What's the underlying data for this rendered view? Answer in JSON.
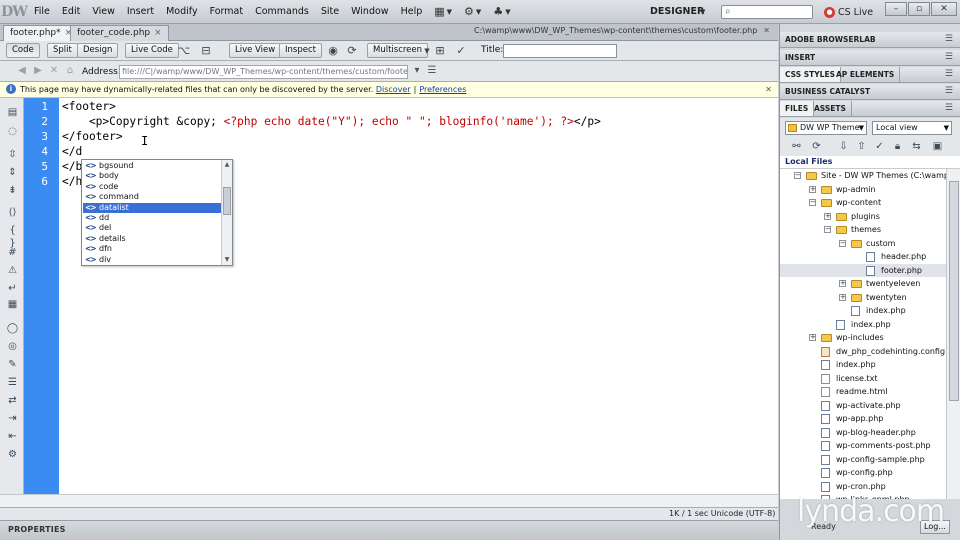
{
  "app": {
    "logo": "DW",
    "workspace": "DESIGNER",
    "cslive": "CS Live",
    "cslive_badge": "●",
    "search_glyph": "⌕"
  },
  "menu": [
    "File",
    "Edit",
    "View",
    "Insert",
    "Modify",
    "Format",
    "Commands",
    "Site",
    "Window",
    "Help"
  ],
  "tabs": [
    {
      "label": "footer.php*"
    },
    {
      "label": "footer_code.php"
    }
  ],
  "file_path": "C:\\wamp\\www\\DW_WP_Themes\\wp-content\\themes\\custom\\footer.php",
  "toolbar": {
    "code": "Code",
    "split": "Split",
    "design": "Design",
    "live_code": "Live Code",
    "live_view": "Live View",
    "inspect": "Inspect",
    "multiscreen": "Multiscreen",
    "title_label": "Title:",
    "title_value": ""
  },
  "address": {
    "label": "Address:",
    "value": "file:///C|/wamp/www/DW_WP_Themes/wp-content/themes/custom/footer.php"
  },
  "infobar": {
    "message": "This page may have dynamically-related files that can only be discovered by the server.",
    "discover": "Discover",
    "separator": "|",
    "preferences": "Preferences"
  },
  "code": {
    "line_numbers": [
      "1",
      "2",
      "3",
      "4",
      "5",
      "6"
    ],
    "lines": [
      {
        "a": "<footer>",
        "b": "",
        "c": ""
      },
      {
        "a": "    <p>Copyright &copy; ",
        "b": "<?php echo date(\"Y\"); echo \" \"; bloginfo('name'); ?>",
        "c": "</p>"
      },
      {
        "a": "</footer>",
        "b": "",
        "c": ""
      },
      {
        "a": "</d",
        "b": "",
        "c": ""
      },
      {
        "a": "</b",
        "b": "",
        "c": ""
      },
      {
        "a": "</h",
        "b": "",
        "c": ""
      }
    ],
    "cursor_glyph": "I"
  },
  "code_hints": {
    "items": [
      "bgsound",
      "body",
      "code",
      "command",
      "datalist",
      "dd",
      "del",
      "details",
      "dfn",
      "div"
    ],
    "selected_index": 4,
    "icon_glyph": "<>"
  },
  "status": {
    "text": "1K / 1 sec  Unicode (UTF-8)"
  },
  "properties": {
    "label": "PROPERTIES"
  },
  "panels": {
    "browserlab": "ADOBE BROWSERLAB",
    "insert": "INSERT",
    "css_styles": "CSS STYLES",
    "ap_elements": "AP ELEMENTS",
    "business_catalyst": "BUSINESS CATALYST",
    "files_tab": "FILES",
    "assets_tab": "ASSETS",
    "site_select": "DW WP Theme",
    "view_select": "Local view",
    "local_files": "Local Files",
    "ready": "Ready",
    "log": "Log..."
  },
  "tree": [
    {
      "label": "Site - DW WP Themes (C:\\wamp\\...",
      "level": 0,
      "kind": "folder",
      "exp": "−"
    },
    {
      "label": "wp-admin",
      "level": 1,
      "kind": "folder",
      "exp": "+"
    },
    {
      "label": "wp-content",
      "level": 1,
      "kind": "folder",
      "exp": "−"
    },
    {
      "label": "plugins",
      "level": 2,
      "kind": "folder",
      "exp": "+"
    },
    {
      "label": "themes",
      "level": 2,
      "kind": "folder",
      "exp": "−"
    },
    {
      "label": "custom",
      "level": 3,
      "kind": "folder",
      "exp": "−"
    },
    {
      "label": "header.php",
      "level": 4,
      "kind": "php",
      "exp": ""
    },
    {
      "label": "footer.php",
      "level": 4,
      "kind": "php",
      "exp": "",
      "selected": true
    },
    {
      "label": "twentyeleven",
      "level": 3,
      "kind": "folder",
      "exp": "+"
    },
    {
      "label": "twentyten",
      "level": 3,
      "kind": "folder",
      "exp": "+"
    },
    {
      "label": "index.php",
      "level": 3,
      "kind": "php",
      "exp": ""
    },
    {
      "label": "index.php",
      "level": 2,
      "kind": "php",
      "exp": ""
    },
    {
      "label": "wp-includes",
      "level": 1,
      "kind": "folder",
      "exp": "+"
    },
    {
      "label": "dw_php_codehinting.config",
      "level": 1,
      "kind": "cfg",
      "exp": ""
    },
    {
      "label": "index.php",
      "level": 1,
      "kind": "php",
      "exp": ""
    },
    {
      "label": "license.txt",
      "level": 1,
      "kind": "file",
      "exp": ""
    },
    {
      "label": "readme.html",
      "level": 1,
      "kind": "file",
      "exp": ""
    },
    {
      "label": "wp-activate.php",
      "level": 1,
      "kind": "php",
      "exp": ""
    },
    {
      "label": "wp-app.php",
      "level": 1,
      "kind": "php",
      "exp": ""
    },
    {
      "label": "wp-blog-header.php",
      "level": 1,
      "kind": "php",
      "exp": ""
    },
    {
      "label": "wp-comments-post.php",
      "level": 1,
      "kind": "php",
      "exp": ""
    },
    {
      "label": "wp-config-sample.php",
      "level": 1,
      "kind": "php",
      "exp": ""
    },
    {
      "label": "wp-config.php",
      "level": 1,
      "kind": "php",
      "exp": ""
    },
    {
      "label": "wp-cron.php",
      "level": 1,
      "kind": "php",
      "exp": ""
    },
    {
      "label": "wp-links-opml.php",
      "level": 1,
      "kind": "php",
      "exp": ""
    }
  ],
  "watermark": "lynda.com",
  "colors": {
    "gutter": "#3b8cf2",
    "php_code": "#c00000",
    "hint_selected": "#3a6fd8",
    "info_bar": "#ffffe1"
  }
}
